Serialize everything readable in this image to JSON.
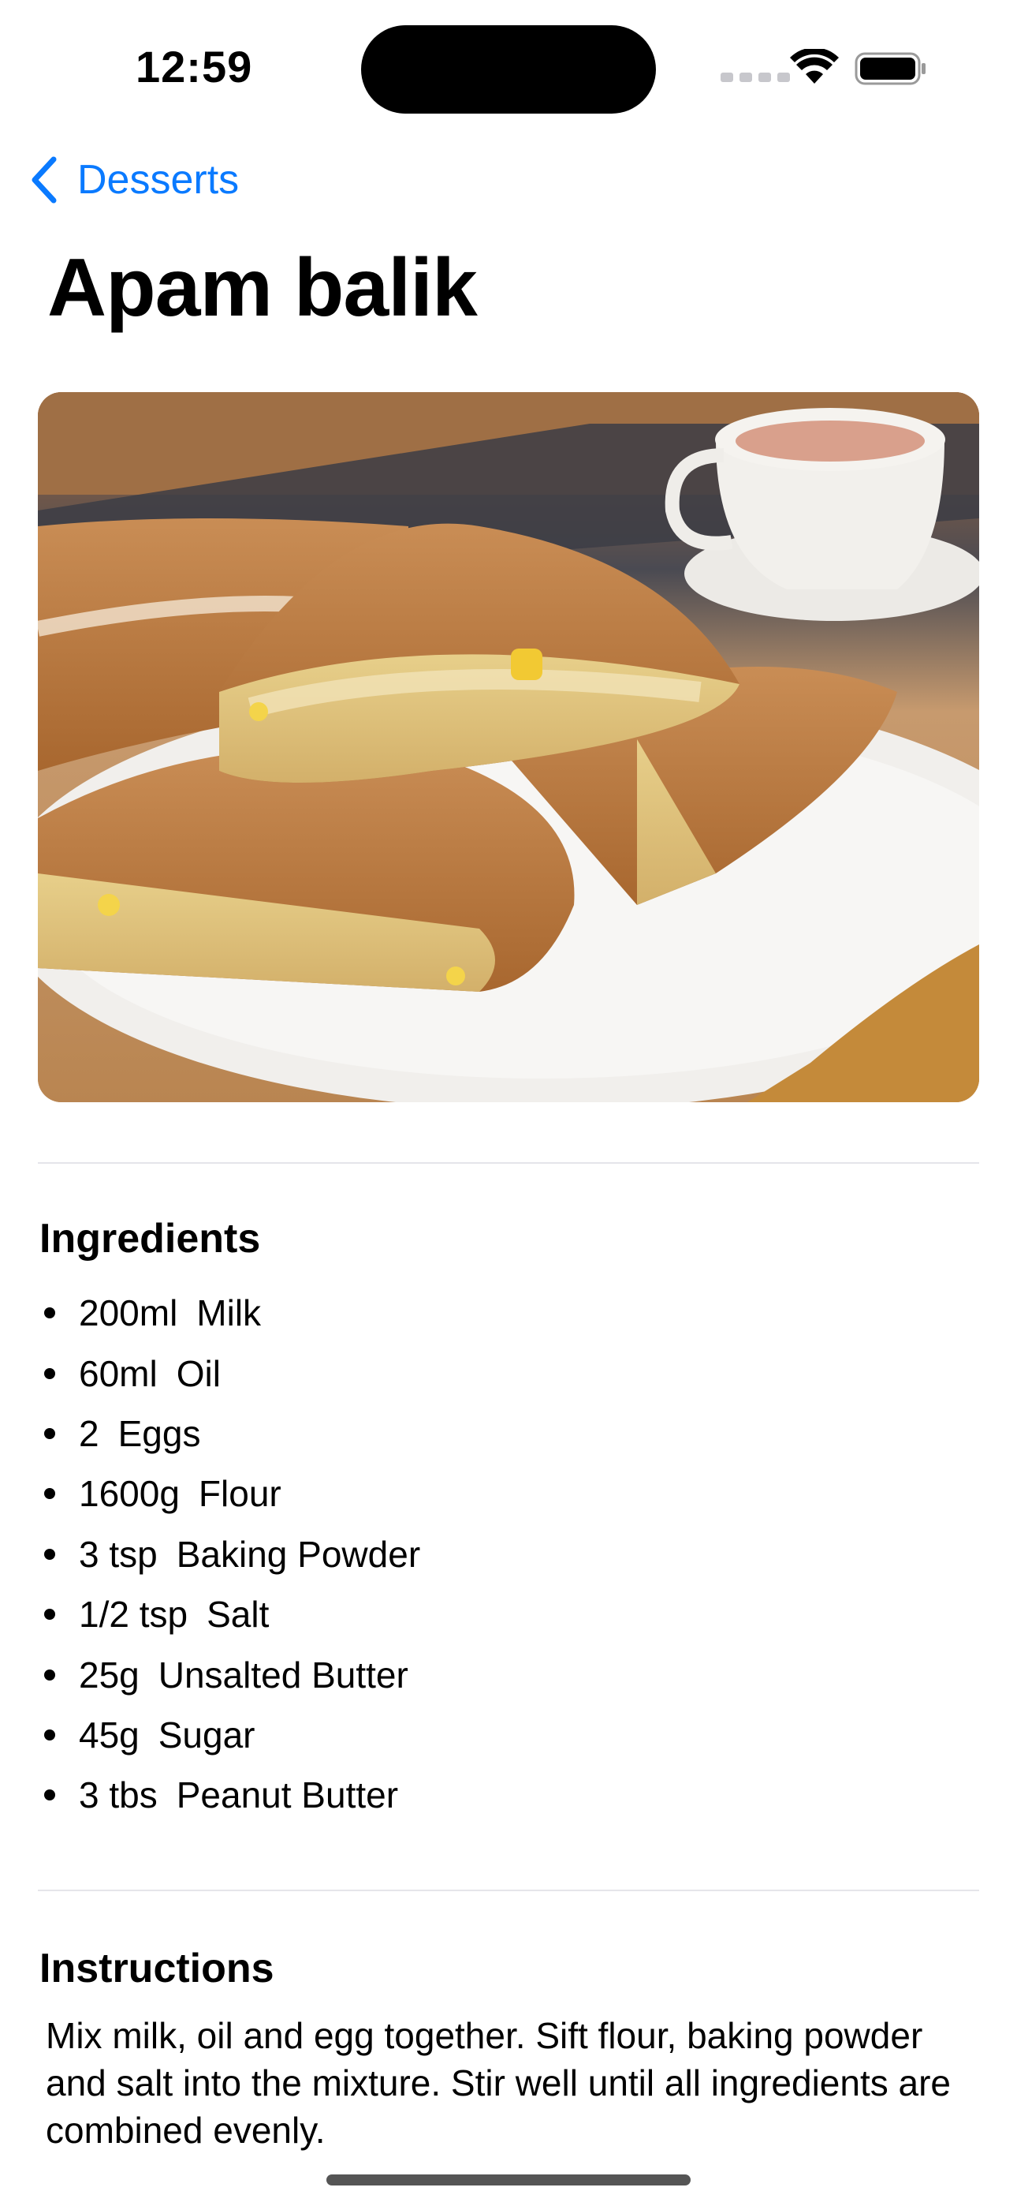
{
  "status_bar": {
    "time": "12:59"
  },
  "nav": {
    "back_label": "Desserts"
  },
  "page": {
    "title": "Apam balik"
  },
  "ingredients": {
    "heading": "Ingredients",
    "items": [
      {
        "measure": "200ml",
        "name": "Milk"
      },
      {
        "measure": "60ml",
        "name": "Oil"
      },
      {
        "measure": "2",
        "name": "Eggs"
      },
      {
        "measure": "1600g",
        "name": "Flour"
      },
      {
        "measure": "3 tsp",
        "name": "Baking Powder"
      },
      {
        "measure": "1/2 tsp",
        "name": "Salt"
      },
      {
        "measure": "25g",
        "name": "Unsalted Butter"
      },
      {
        "measure": "45g",
        "name": "Sugar"
      },
      {
        "measure": "3 tbs",
        "name": "Peanut Butter"
      }
    ]
  },
  "instructions": {
    "heading": "Instructions",
    "text": "Mix milk, oil and egg together. Sift flour, baking powder and salt into the mixture. Stir well until all ingredients are combined evenly."
  },
  "colors": {
    "accent": "#0a7aff",
    "divider": "#e5e5ea"
  }
}
